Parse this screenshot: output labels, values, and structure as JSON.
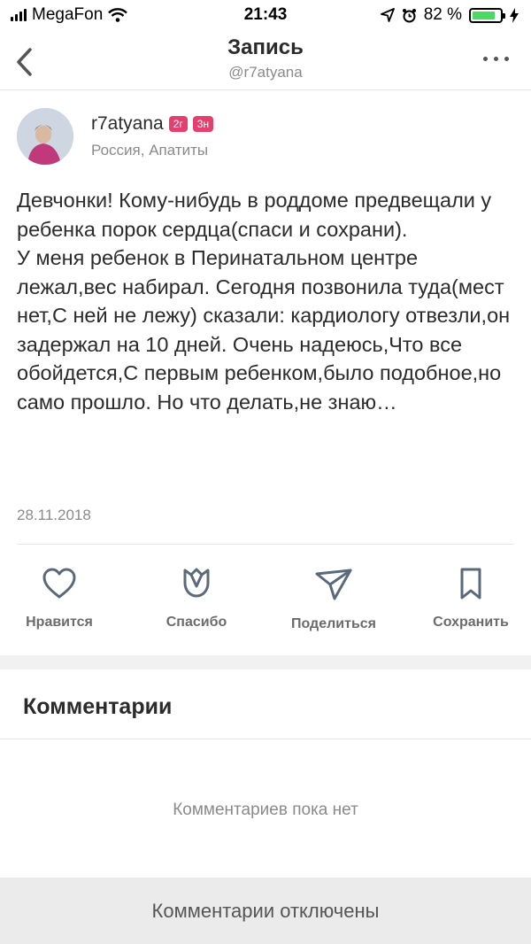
{
  "status_bar": {
    "carrier": "MegaFon",
    "time": "21:43",
    "battery": "82 %",
    "battery_level": 0.82
  },
  "nav": {
    "title": "Запись",
    "subtitle": "@r7atyana"
  },
  "post": {
    "author": "r7atyana",
    "badges": [
      "2г",
      "3н"
    ],
    "location": "Россия, Апатиты",
    "text": "Девчонки! Кому-нибудь в роддоме предвещали у ребенка порок сердца(спаси и сохрани).\nУ меня ребенок в Перинатальном центре лежал,вес набирал. Сегодня позвонила туда(мест нет,С ней не лежу) сказали: кардиологу отвезли,он задержал на 10 дней. Очень надеюсь,Что все обойдется,С первым ребенком,было подобное,но само прошло. Но что делать,не знаю…",
    "date": "28.11.2018"
  },
  "actions": {
    "like": "Нравится",
    "thanks": "Спасибо",
    "share": "Поделиться",
    "save": "Сохранить"
  },
  "comments": {
    "title": "Комментарии",
    "empty": "Комментариев пока нет",
    "disabled": "Комментарии отключены"
  },
  "icons": {
    "back": "chevron-left-icon",
    "more": "more-dots-icon",
    "like": "heart-icon",
    "thanks": "tulip-icon",
    "share": "paper-plane-icon",
    "save": "bookmark-icon"
  },
  "colors": {
    "badge": "#e4406f",
    "battery": "#4cd964"
  }
}
